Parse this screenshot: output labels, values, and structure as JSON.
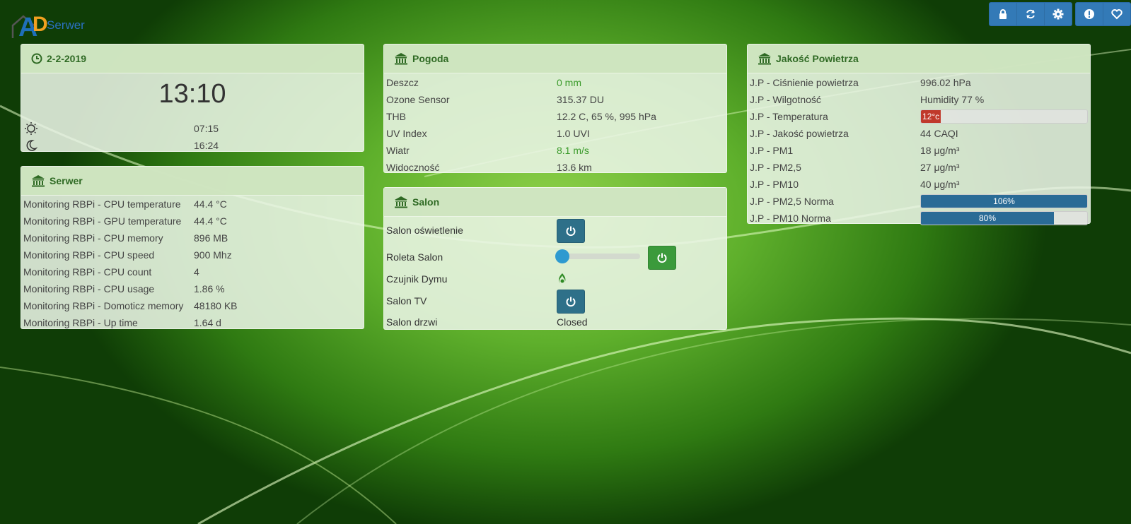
{
  "header": {
    "logo_a": "A",
    "logo_d": "D",
    "app_name": "Serwer"
  },
  "toolbar": {
    "buttons": [
      {
        "icon": "lock-icon"
      },
      {
        "icon": "refresh-icon"
      },
      {
        "icon": "gear-icon"
      },
      {
        "icon": "info-icon"
      },
      {
        "icon": "heart-icon"
      }
    ]
  },
  "clock_panel": {
    "date": "2-2-2019",
    "time": "13:10",
    "sunrise": "07:15",
    "sunset": "16:24"
  },
  "server_panel": {
    "title": "Serwer",
    "rows": [
      {
        "label": "Monitoring RBPi - CPU temperature",
        "value": "44.4 °C"
      },
      {
        "label": "Monitoring RBPi - GPU temperature",
        "value": "44.4 °C"
      },
      {
        "label": "Monitoring RBPi - CPU memory",
        "value": "896 MB"
      },
      {
        "label": "Monitoring RBPi - CPU speed",
        "value": "900 Mhz"
      },
      {
        "label": "Monitoring RBPi - CPU count",
        "value": "4"
      },
      {
        "label": "Monitoring RBPi - CPU usage",
        "value": "1.86 %"
      },
      {
        "label": "Monitoring RBPi - Domoticz memory",
        "value": "48180 KB"
      },
      {
        "label": "Monitoring RBPi - Up time",
        "value": "1.64 d"
      }
    ]
  },
  "weather_panel": {
    "title": "Pogoda",
    "rows": [
      {
        "label": "Deszcz",
        "value": "0 mm",
        "color": "#3a9a2a"
      },
      {
        "label": "Ozone Sensor",
        "value": "315.37 DU",
        "color": "#444444"
      },
      {
        "label": "THB",
        "value": "12.2 C, 65 %, 995 hPa",
        "color": "#444444"
      },
      {
        "label": "UV Index",
        "value": "1.0 UVI",
        "color": "#444444"
      },
      {
        "label": "Wiatr",
        "value": "8.1 m/s",
        "color": "#3a9a2a"
      },
      {
        "label": "Widoczność",
        "value": "13.6 km",
        "color": "#444444"
      }
    ]
  },
  "salon_panel": {
    "title": "Salon",
    "light_label": "Salon oświetlenie",
    "blind_label": "Roleta Salon",
    "blind_level": 0,
    "smoke_label": "Czujnik Dymu",
    "tv_label": "Salon TV",
    "door_label": "Salon drzwi",
    "door_value": "Closed"
  },
  "air_panel": {
    "title": "Jakość Powietrza",
    "rows": [
      {
        "label": "J.P - Ciśnienie powietrza",
        "value": "996.02 hPa"
      },
      {
        "label": "J.P - Wilgotność",
        "value": "Humidity 77 %"
      },
      {
        "label": "J.P - Jakość powietrza",
        "value": "44 CAQI"
      },
      {
        "label": "J.P - PM1",
        "value": "18 μg/m³"
      },
      {
        "label": "J.P - PM2,5",
        "value": "27 μg/m³"
      },
      {
        "label": "J.P - PM10",
        "value": "40 μg/m³"
      }
    ],
    "temperature": {
      "label": "J.P - Temperatura",
      "value": "12°c",
      "fraction": 0.12,
      "color": "#c0392b"
    },
    "pm25_norm": {
      "label": "J.P - PM2,5 Norma",
      "value": "106%",
      "fraction": 1.0,
      "color": "#2a6b96"
    },
    "pm10_norm": {
      "label": "J.P - PM10 Norma",
      "value": "80%",
      "fraction": 0.8,
      "color": "#2a6b96"
    }
  }
}
